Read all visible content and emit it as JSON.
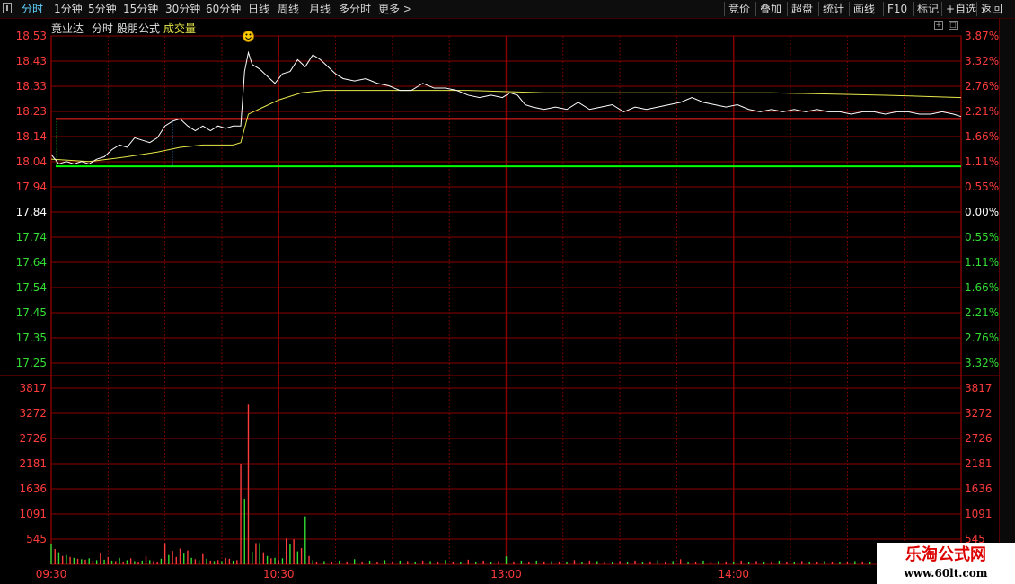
{
  "toolbar": {
    "left": [
      "分时",
      "1分钟",
      "5分钟",
      "15分钟",
      "30分钟",
      "60分钟",
      "日线",
      "周线",
      "月线",
      "多分时",
      "更多 >"
    ],
    "right": [
      "竞价",
      "叠加",
      "超盘",
      "统计",
      "画线",
      "F10",
      "标记",
      "+自选",
      "返回"
    ]
  },
  "header": {
    "name": "竟业达",
    "mode": "分时",
    "formula": "股朋公式",
    "volume": "成交量"
  },
  "colors": {
    "price_line": "#ffffff",
    "avg_line": "#e8e84a",
    "up": "#ff3b3b",
    "down": "#33dd33",
    "grid": "#8b0000",
    "resistance": "#ff2020",
    "support": "#00ff00",
    "neutral": "#ffffff"
  },
  "icons": {
    "marker": "smiley-face-icon",
    "menu": "menu-icon"
  },
  "chart_data": {
    "type": "line",
    "price_axis": {
      "ylim": [
        17.15,
        18.53
      ],
      "ticks": [
        "18.53",
        "18.43",
        "18.33",
        "18.23",
        "18.14",
        "18.04",
        "17.94",
        "17.84",
        "17.74",
        "17.64",
        "17.54",
        "17.45",
        "17.35",
        "17.25"
      ],
      "pct_ticks": [
        "3.87%",
        "3.32%",
        "2.76%",
        "2.21%",
        "1.66%",
        "1.11%",
        "0.55%",
        "0.00%",
        "0.55%",
        "1.11%",
        "1.66%",
        "2.21%",
        "2.76%",
        "3.32%"
      ],
      "prev_close": 17.84
    },
    "volume_axis": {
      "ylim": [
        0,
        3817
      ],
      "ticks": [
        "3817",
        "3272",
        "2726",
        "2181",
        "1636",
        "1091",
        "545"
      ]
    },
    "time_ticks": [
      "09:30",
      "10:30",
      "13:00",
      "14:00"
    ],
    "minutes_total": 240,
    "resistance": 18.18,
    "support": 17.98,
    "price": [
      [
        0,
        18.03
      ],
      [
        2,
        17.99
      ],
      [
        4,
        18.0
      ],
      [
        6,
        17.99
      ],
      [
        8,
        18.0
      ],
      [
        10,
        17.99
      ],
      [
        12,
        18.01
      ],
      [
        14,
        18.02
      ],
      [
        16,
        18.05
      ],
      [
        18,
        18.07
      ],
      [
        20,
        18.06
      ],
      [
        22,
        18.1
      ],
      [
        24,
        18.09
      ],
      [
        26,
        18.08
      ],
      [
        28,
        18.1
      ],
      [
        30,
        18.15
      ],
      [
        32,
        18.17
      ],
      [
        34,
        18.18
      ],
      [
        36,
        18.15
      ],
      [
        38,
        18.13
      ],
      [
        40,
        18.15
      ],
      [
        42,
        18.13
      ],
      [
        44,
        18.15
      ],
      [
        46,
        18.14
      ],
      [
        48,
        18.15
      ],
      [
        50,
        18.15
      ],
      [
        51,
        18.38
      ],
      [
        52,
        18.46
      ],
      [
        53,
        18.41
      ],
      [
        55,
        18.39
      ],
      [
        57,
        18.36
      ],
      [
        59,
        18.33
      ],
      [
        61,
        18.37
      ],
      [
        63,
        18.38
      ],
      [
        65,
        18.43
      ],
      [
        67,
        18.4
      ],
      [
        69,
        18.45
      ],
      [
        71,
        18.43
      ],
      [
        73,
        18.4
      ],
      [
        75,
        18.37
      ],
      [
        77,
        18.35
      ],
      [
        80,
        18.34
      ],
      [
        83,
        18.35
      ],
      [
        86,
        18.33
      ],
      [
        89,
        18.32
      ],
      [
        92,
        18.3
      ],
      [
        95,
        18.3
      ],
      [
        98,
        18.33
      ],
      [
        101,
        18.31
      ],
      [
        104,
        18.31
      ],
      [
        107,
        18.3
      ],
      [
        110,
        18.28
      ],
      [
        113,
        18.27
      ],
      [
        116,
        18.28
      ],
      [
        119,
        18.27
      ],
      [
        121,
        18.29
      ],
      [
        123,
        18.28
      ],
      [
        125,
        18.24
      ],
      [
        127,
        18.23
      ],
      [
        130,
        18.22
      ],
      [
        133,
        18.23
      ],
      [
        136,
        18.22
      ],
      [
        139,
        18.25
      ],
      [
        142,
        18.22
      ],
      [
        145,
        18.23
      ],
      [
        148,
        18.24
      ],
      [
        151,
        18.21
      ],
      [
        154,
        18.23
      ],
      [
        157,
        18.22
      ],
      [
        160,
        18.23
      ],
      [
        163,
        18.24
      ],
      [
        166,
        18.25
      ],
      [
        169,
        18.27
      ],
      [
        172,
        18.25
      ],
      [
        175,
        18.24
      ],
      [
        178,
        18.23
      ],
      [
        181,
        18.24
      ],
      [
        184,
        18.22
      ],
      [
        187,
        18.21
      ],
      [
        190,
        18.22
      ],
      [
        193,
        18.21
      ],
      [
        196,
        18.22
      ],
      [
        199,
        18.21
      ],
      [
        202,
        18.22
      ],
      [
        205,
        18.21
      ],
      [
        208,
        18.21
      ],
      [
        211,
        18.2
      ],
      [
        214,
        18.21
      ],
      [
        217,
        18.21
      ],
      [
        220,
        18.2
      ],
      [
        223,
        18.21
      ],
      [
        226,
        18.21
      ],
      [
        229,
        18.2
      ],
      [
        232,
        18.2
      ],
      [
        235,
        18.21
      ],
      [
        238,
        18.2
      ],
      [
        240,
        18.19
      ]
    ],
    "avg": [
      [
        0,
        18.01
      ],
      [
        10,
        18.0
      ],
      [
        20,
        18.02
      ],
      [
        28,
        18.04
      ],
      [
        34,
        18.06
      ],
      [
        40,
        18.07
      ],
      [
        48,
        18.07
      ],
      [
        50,
        18.08
      ],
      [
        52,
        18.2
      ],
      [
        56,
        18.23
      ],
      [
        60,
        18.26
      ],
      [
        66,
        18.29
      ],
      [
        72,
        18.3
      ],
      [
        90,
        18.3
      ],
      [
        110,
        18.3
      ],
      [
        130,
        18.29
      ],
      [
        160,
        18.29
      ],
      [
        190,
        18.29
      ],
      [
        220,
        18.28
      ],
      [
        240,
        18.27
      ]
    ],
    "volume": [
      [
        0,
        "down",
        450
      ],
      [
        1,
        "up",
        330
      ],
      [
        2,
        "down",
        260
      ],
      [
        3,
        "up",
        180
      ],
      [
        4,
        "down",
        200
      ],
      [
        5,
        "up",
        160
      ],
      [
        6,
        "down",
        140
      ],
      [
        7,
        "up",
        120
      ],
      [
        8,
        "down",
        110
      ],
      [
        9,
        "up",
        100
      ],
      [
        10,
        "down",
        130
      ],
      [
        11,
        "up",
        80
      ],
      [
        12,
        "down",
        90
      ],
      [
        13,
        "up",
        240
      ],
      [
        14,
        "down",
        100
      ],
      [
        15,
        "up",
        160
      ],
      [
        16,
        "down",
        80
      ],
      [
        17,
        "up",
        70
      ],
      [
        18,
        "down",
        140
      ],
      [
        19,
        "up",
        60
      ],
      [
        20,
        "down",
        90
      ],
      [
        21,
        "up",
        130
      ],
      [
        22,
        "down",
        70
      ],
      [
        23,
        "up",
        60
      ],
      [
        24,
        "down",
        80
      ],
      [
        25,
        "up",
        180
      ],
      [
        26,
        "down",
        90
      ],
      [
        27,
        "up",
        70
      ],
      [
        28,
        "up",
        60
      ],
      [
        29,
        "down",
        120
      ],
      [
        30,
        "up",
        460
      ],
      [
        31,
        "down",
        200
      ],
      [
        32,
        "up",
        290
      ],
      [
        33,
        "up",
        160
      ],
      [
        34,
        "up",
        340
      ],
      [
        35,
        "down",
        230
      ],
      [
        36,
        "up",
        300
      ],
      [
        37,
        "down",
        140
      ],
      [
        38,
        "up",
        110
      ],
      [
        39,
        "down",
        90
      ],
      [
        40,
        "up",
        220
      ],
      [
        41,
        "down",
        120
      ],
      [
        42,
        "up",
        80
      ],
      [
        43,
        "down",
        70
      ],
      [
        44,
        "up",
        90
      ],
      [
        45,
        "down",
        70
      ],
      [
        46,
        "up",
        140
      ],
      [
        47,
        "up",
        120
      ],
      [
        48,
        "down",
        80
      ],
      [
        49,
        "up",
        90
      ],
      [
        50,
        "up",
        2180
      ],
      [
        51,
        "down",
        1420
      ],
      [
        52,
        "up",
        3460
      ],
      [
        53,
        "down",
        270
      ],
      [
        54,
        "up",
        460
      ],
      [
        55,
        "down",
        460
      ],
      [
        56,
        "up",
        260
      ],
      [
        57,
        "down",
        180
      ],
      [
        58,
        "up",
        130
      ],
      [
        59,
        "down",
        140
      ],
      [
        60,
        "up",
        90
      ],
      [
        61,
        "down",
        130
      ],
      [
        62,
        "up",
        560
      ],
      [
        63,
        "down",
        430
      ],
      [
        64,
        "up",
        540
      ],
      [
        65,
        "down",
        280
      ],
      [
        66,
        "up",
        350
      ],
      [
        67,
        "down",
        1040
      ],
      [
        68,
        "up",
        180
      ],
      [
        69,
        "down",
        90
      ],
      [
        70,
        "up",
        60
      ],
      [
        72,
        "down",
        70
      ],
      [
        74,
        "up",
        60
      ],
      [
        76,
        "down",
        80
      ],
      [
        78,
        "up",
        60
      ],
      [
        80,
        "down",
        110
      ],
      [
        82,
        "up",
        60
      ],
      [
        84,
        "down",
        80
      ],
      [
        86,
        "up",
        60
      ],
      [
        88,
        "down",
        90
      ],
      [
        90,
        "up",
        60
      ],
      [
        92,
        "down",
        80
      ],
      [
        94,
        "up",
        70
      ],
      [
        96,
        "down",
        60
      ],
      [
        98,
        "up",
        80
      ],
      [
        100,
        "down",
        70
      ],
      [
        102,
        "up",
        60
      ],
      [
        104,
        "down",
        90
      ],
      [
        106,
        "up",
        60
      ],
      [
        108,
        "down",
        60
      ],
      [
        110,
        "up",
        100
      ],
      [
        112,
        "down",
        60
      ],
      [
        114,
        "up",
        80
      ],
      [
        116,
        "down",
        60
      ],
      [
        118,
        "up",
        70
      ],
      [
        120,
        "down",
        170
      ],
      [
        122,
        "up",
        60
      ],
      [
        124,
        "down",
        80
      ],
      [
        126,
        "up",
        60
      ],
      [
        128,
        "down",
        80
      ],
      [
        130,
        "up",
        60
      ],
      [
        132,
        "down",
        70
      ],
      [
        134,
        "up",
        60
      ],
      [
        136,
        "down",
        60
      ],
      [
        138,
        "up",
        90
      ],
      [
        140,
        "down",
        60
      ],
      [
        142,
        "up",
        80
      ],
      [
        144,
        "down",
        70
      ],
      [
        146,
        "up",
        60
      ],
      [
        148,
        "down",
        60
      ],
      [
        150,
        "up",
        70
      ],
      [
        152,
        "down",
        60
      ],
      [
        154,
        "up",
        80
      ],
      [
        156,
        "down",
        60
      ],
      [
        158,
        "up",
        60
      ],
      [
        160,
        "down",
        90
      ],
      [
        162,
        "up",
        60
      ],
      [
        164,
        "down",
        70
      ],
      [
        166,
        "up",
        110
      ],
      [
        168,
        "down",
        60
      ],
      [
        170,
        "up",
        60
      ],
      [
        172,
        "down",
        80
      ],
      [
        174,
        "up",
        60
      ],
      [
        176,
        "down",
        70
      ],
      [
        178,
        "up",
        60
      ],
      [
        180,
        "down",
        60
      ],
      [
        182,
        "up",
        80
      ],
      [
        184,
        "down",
        60
      ],
      [
        186,
        "up",
        70
      ],
      [
        188,
        "down",
        60
      ],
      [
        190,
        "up",
        60
      ],
      [
        192,
        "down",
        80
      ],
      [
        194,
        "up",
        60
      ],
      [
        196,
        "down",
        60
      ],
      [
        198,
        "up",
        70
      ],
      [
        200,
        "down",
        60
      ],
      [
        202,
        "up",
        60
      ],
      [
        204,
        "down",
        70
      ],
      [
        206,
        "up",
        60
      ],
      [
        208,
        "down",
        60
      ],
      [
        210,
        "up",
        60
      ],
      [
        212,
        "down",
        70
      ],
      [
        214,
        "up",
        60
      ],
      [
        216,
        "down",
        60
      ],
      [
        218,
        "up",
        60
      ],
      [
        220,
        "down",
        60
      ],
      [
        222,
        "up",
        60
      ],
      [
        224,
        "down",
        60
      ],
      [
        226,
        "up",
        60
      ],
      [
        228,
        "down",
        60
      ],
      [
        230,
        "up",
        60
      ],
      [
        232,
        "down",
        60
      ]
    ]
  },
  "watermark": {
    "title": "乐淘公式网",
    "url": "www.60lt.com"
  }
}
